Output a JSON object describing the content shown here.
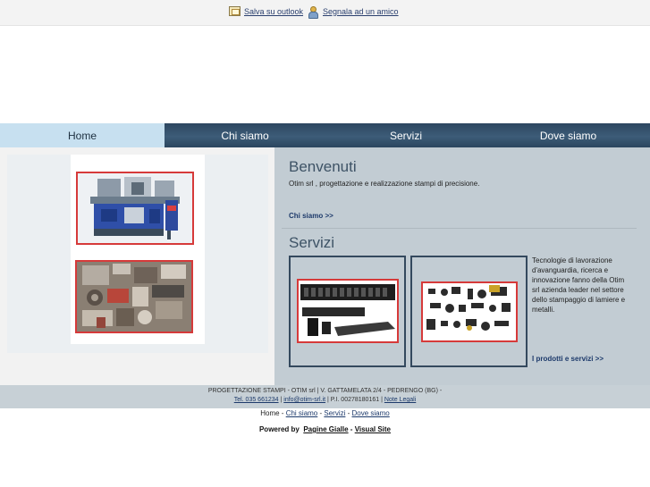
{
  "topbar": {
    "outlook_label": "Salva su outlook",
    "friend_label": "Segnala ad un amico",
    "outlook_icon": "envelope-icon",
    "friend_icon": "person-icon"
  },
  "nav": {
    "items": [
      {
        "label": "Home",
        "active": true
      },
      {
        "label": "Chi siamo",
        "active": false
      },
      {
        "label": "Servizi",
        "active": false
      },
      {
        "label": "Dove siamo",
        "active": false
      }
    ]
  },
  "welcome": {
    "title": "Benvenuti",
    "intro": "Otim srl , progettazione e realizzazione stampi di precisione.",
    "more_link": "Chi siamo >>"
  },
  "services": {
    "title": "Servizi",
    "description": "Tecnologie di lavorazione d'avanguardia, ricerca e innovazione fanno della Otim srl azienda leader nel settore dello stampaggio di lamiere e metalli.",
    "more_link": "I prodotti e servizi >>"
  },
  "footer": {
    "company": "PROGETTAZIONE STAMPI - OTIM srl | V. GATTAMELATA 2/4 - PEDRENGO (BG) -",
    "phone": "Tel. 035 661234",
    "sep1": " | ",
    "email": "info@otim-srl.it",
    "piva": " | P.I. 00278180161 | ",
    "legal": "Note Legali"
  },
  "bottom_nav": {
    "items": [
      "Home",
      "Chi siamo",
      "Servizi",
      "Dove siamo"
    ],
    "separator": " - "
  },
  "powered": {
    "prefix": "Powered by",
    "link1": "Pagine Gialle",
    "sep": " - ",
    "link2": "Visual Site"
  },
  "colors": {
    "nav_bg": "#34506b",
    "nav_active": "#c7e0f0",
    "accent_red": "#d63a3a",
    "content_bg": "#c2ccd3",
    "title_color": "#3e5366"
  }
}
